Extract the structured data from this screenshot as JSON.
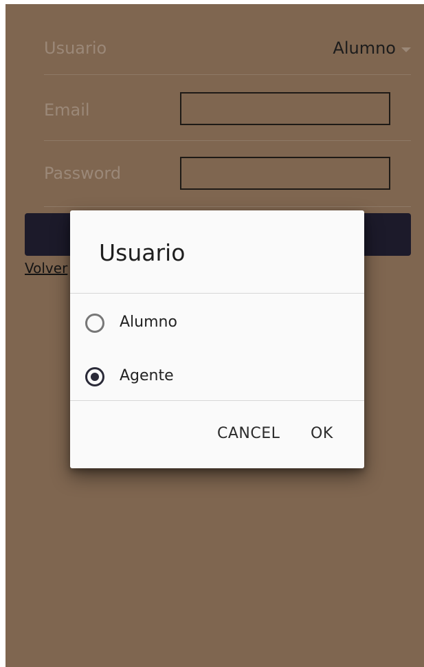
{
  "form": {
    "user_label": "Usuario",
    "user_value": "Alumno",
    "email_label": "Email",
    "password_label": "Password",
    "back_link": "Volver"
  },
  "dialog": {
    "title": "Usuario",
    "options": [
      {
        "label": "Alumno",
        "selected": false
      },
      {
        "label": "Agente",
        "selected": true
      }
    ],
    "cancel_label": "CANCEL",
    "ok_label": "OK"
  },
  "colors": {
    "background": "#7f6650",
    "submit_bar": "#1c1a2a",
    "dialog": "#fafafa"
  }
}
